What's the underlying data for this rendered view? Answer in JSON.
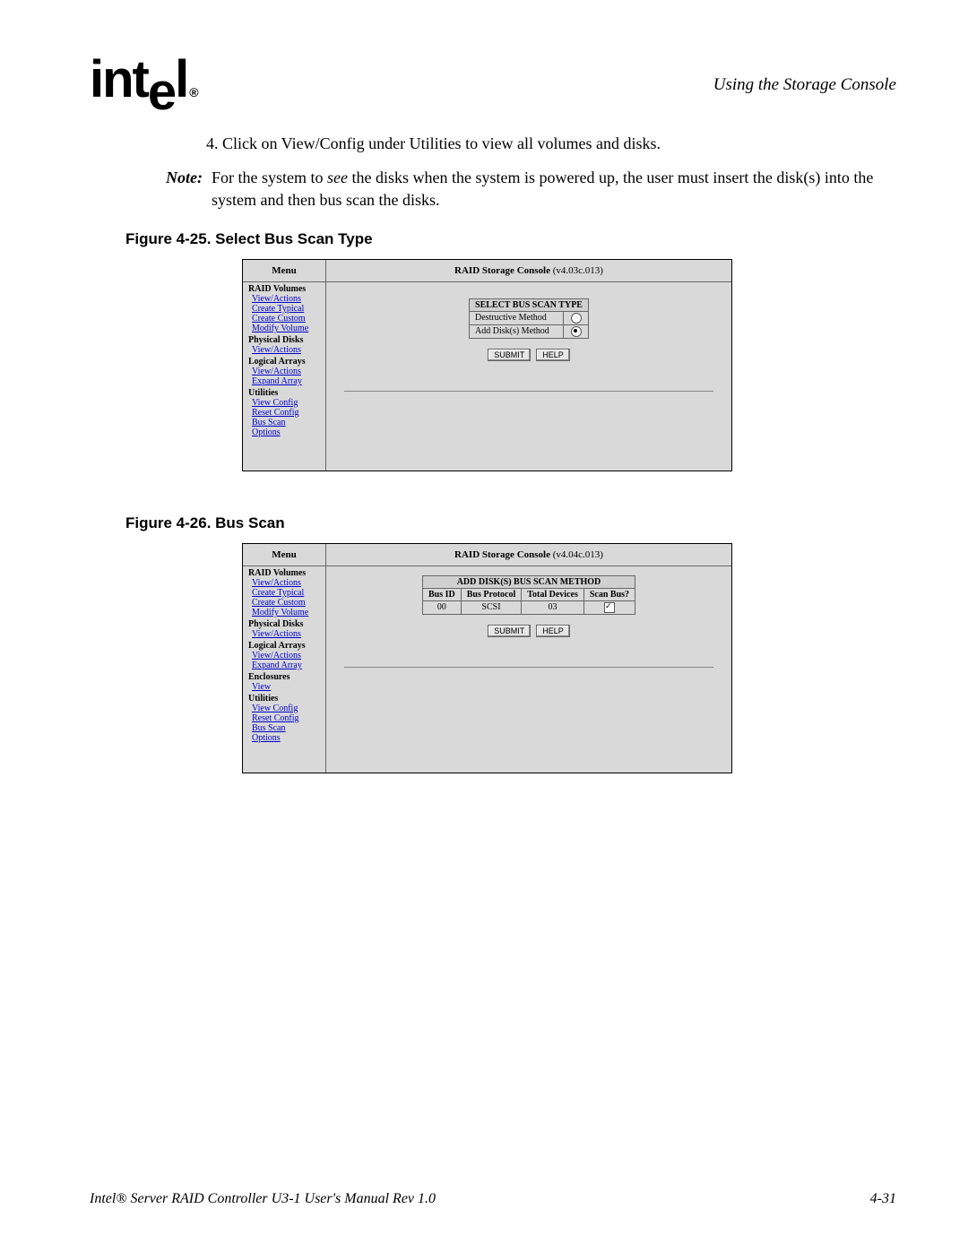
{
  "header": {
    "logo_text": "intel",
    "logo_reg": "®",
    "section_title": "Using the Storage Console"
  },
  "body": {
    "step4": "4.  Click on View/Config under Utilities to view all volumes and disks.",
    "note_label": "Note:",
    "note_text_pre": "For the system to ",
    "note_text_em": "see",
    "note_text_post": " the disks when the system is powered up, the user must insert the disk(s) into the system and then bus scan the disks."
  },
  "fig25": {
    "caption": "Figure 4-25. Select Bus Scan Type",
    "menu_header": "Menu",
    "main_title_bold": "RAID Storage Console",
    "main_title_ver": " (v4.03c.013)",
    "menu": {
      "raid_volumes": "RAID Volumes",
      "view_actions": "View/Actions",
      "create_typical": "Create Typical",
      "create_custom": "Create Custom",
      "modify_volume": "Modify Volume",
      "physical_disks": "Physical Disks",
      "logical_arrays": "Logical Arrays",
      "expand_array": "Expand Array",
      "utilities": "Utilities",
      "view_config": "View Config",
      "reset_config": "Reset Config",
      "bus_scan": "Bus Scan",
      "options": "Options"
    },
    "panel": {
      "title": "SELECT BUS SCAN TYPE",
      "row1": "Destructive Method",
      "row2": "Add Disk(s) Method",
      "submit": "SUBMIT",
      "help": "HELP"
    }
  },
  "fig26": {
    "caption": "Figure 4-26. Bus Scan",
    "menu_header": "Menu",
    "main_title_bold": "RAID Storage Console",
    "main_title_ver": " (v4.04c.013)",
    "menu": {
      "raid_volumes": "RAID Volumes",
      "view_actions": "View/Actions",
      "create_typical": "Create Typical",
      "create_custom": "Create Custom",
      "modify_volume": "Modify Volume",
      "physical_disks": "Physical Disks",
      "logical_arrays": "Logical Arrays",
      "expand_array": "Expand Array",
      "enclosures": "Enclosures",
      "view": "View",
      "utilities": "Utilities",
      "view_config": "View Config",
      "reset_config": "Reset Config",
      "bus_scan": "Bus Scan",
      "options": "Options"
    },
    "panel": {
      "title": "ADD DISK(S) BUS SCAN METHOD",
      "h_bus_id": "Bus ID",
      "h_bus_protocol": "Bus Protocol",
      "h_total_devices": "Total Devices",
      "h_scan_bus": "Scan Bus?",
      "v_bus_id": "00",
      "v_bus_protocol": "SCSI",
      "v_total_devices": "03",
      "submit": "SUBMIT",
      "help": "HELP"
    }
  },
  "footer": {
    "left": "Intel® Server RAID Controller U3-1 User's Manual Rev 1.0",
    "right": "4-31"
  }
}
